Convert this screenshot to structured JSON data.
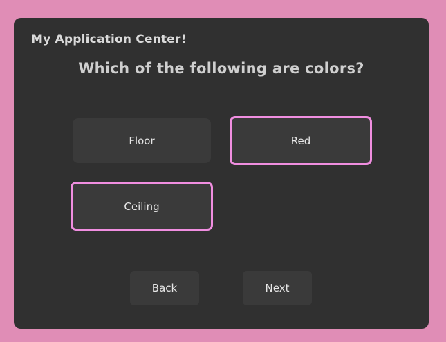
{
  "app": {
    "title": "My Application Center!"
  },
  "question": {
    "text": "Which of the following are colors?"
  },
  "options": [
    {
      "label": "Floor",
      "selected": false
    },
    {
      "label": "Red",
      "selected": true
    },
    {
      "label": "Ceiling",
      "selected": true
    }
  ],
  "nav": {
    "back_label": "Back",
    "next_label": "Next"
  },
  "colors": {
    "background": "#e08db6",
    "panel": "#303030",
    "option_bg": "#3a3a3a",
    "selected_outline": "#f08ee0",
    "text": "#e6e6e6"
  }
}
